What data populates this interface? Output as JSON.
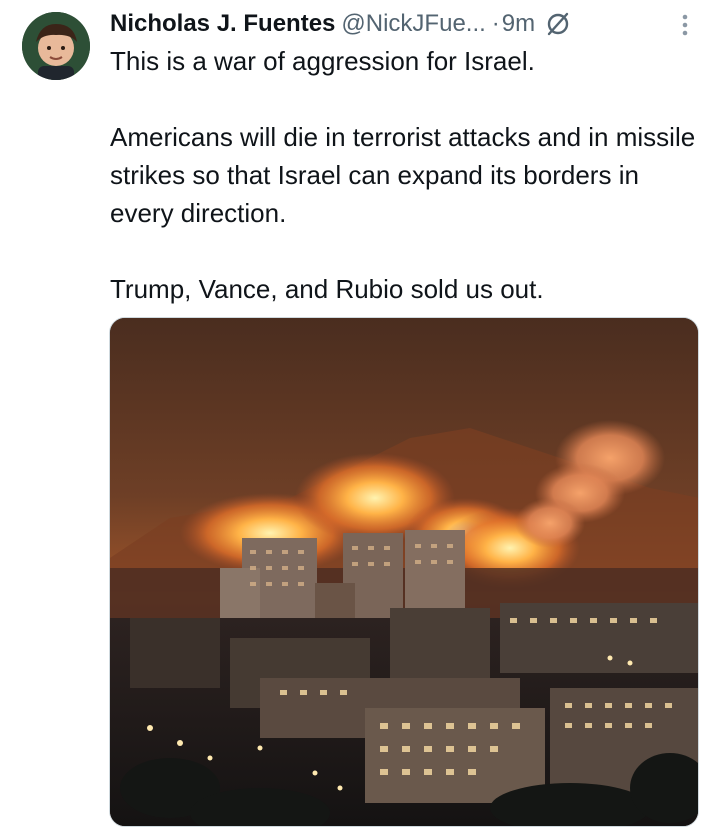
{
  "author": {
    "name": "Nicholas J. Fuentes",
    "handle": "@NickJFue...",
    "separator": "·",
    "time": "9m"
  },
  "tweet": {
    "lines": [
      "This is a war of aggression for Israel.",
      "Americans will die in terrorist attacks and in missile strikes so that Israel can expand its borders in every direction.",
      "Trump, Vance, and Rubio sold us out."
    ]
  },
  "icons": {
    "muted": "mute-slash-circle-icon",
    "more": "more-vertical-icon"
  },
  "colors": {
    "text": "#0f1419",
    "secondary": "#536471"
  }
}
